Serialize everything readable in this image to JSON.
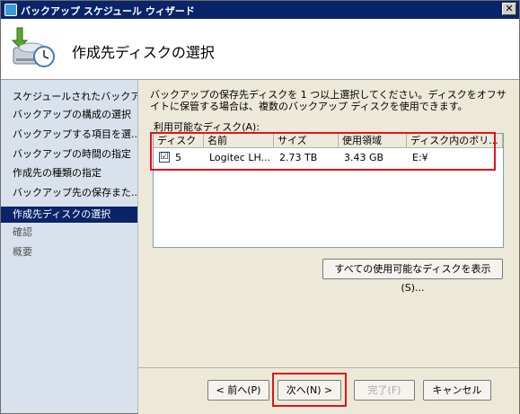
{
  "window": {
    "title": "バックアップ スケジュール ウィザード",
    "close_label": "✕"
  },
  "header": {
    "title": "作成先ディスクの選択",
    "icon": "backup-schedule-icon"
  },
  "sidebar": {
    "items": [
      {
        "label": "スケジュールされたバックア..."
      },
      {
        "label": "バックアップの構成の選択"
      },
      {
        "label": "バックアップする項目を選..."
      },
      {
        "label": "バックアップの時間の指定"
      },
      {
        "label": "作成先の種類の指定"
      },
      {
        "label": "バックアップ先の保存また..."
      },
      {
        "label": "作成先ディスクの選択"
      },
      {
        "label": "確認"
      },
      {
        "label": "概要"
      }
    ],
    "active_index": 6
  },
  "content": {
    "description": "バックアップの保存先ディスクを 1 つ以上選択してください。ディスクをオフサイトに保管する場合は、複数のバックアップ ディスクを使用できます。",
    "list_label": "利用可能なディスク(A):",
    "columns": [
      "ディスク",
      "名前",
      "サイズ",
      "使用領域",
      "ディスク内のボリ..."
    ],
    "rows": [
      {
        "checked": "☑",
        "disk": "5",
        "name": "Logitec LH...",
        "size": "2.73 TB",
        "used": "3.43 GB",
        "volumes": "E:¥"
      }
    ],
    "show_all_button": "すべての使用可能なディスクを表示(S)..."
  },
  "footer": {
    "back_button": "< 前へ(P)",
    "next_button": "次へ(N) >",
    "finish_button": "完了(F)",
    "cancel_button": "キャンセル"
  },
  "colors": {
    "highlight": "#e2141c",
    "active": "#0a246a"
  }
}
